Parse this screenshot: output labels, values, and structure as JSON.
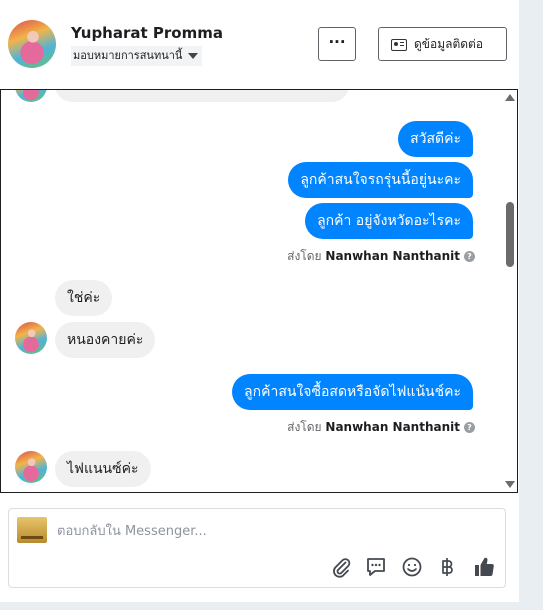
{
  "header": {
    "name": "Yupharat Promma",
    "assign_label": "มอบหมายการสนทนานี้",
    "more_label": "···",
    "contact_label": "ดูข้อมูลติดต่อ"
  },
  "messages": {
    "out_1": "สวัสดีค่ะ",
    "out_2": "ลูกค้าสนใจรถรุ่นนี้อยู่นะคะ",
    "out_3": "ลูกค้า  อยู่จังหวัดอะไรคะ",
    "sent_by_1_prefix": "ส่งโดย",
    "sent_by_1_name": "Nanwhan Nanthanit",
    "in_1": "ใช่ค่ะ",
    "in_2": "หนองคายค่ะ",
    "out_4": "ลูกค้าสนใจซื้อสดหรือจัดไฟแน้นช์คะ",
    "sent_by_2_prefix": "ส่งโดย",
    "sent_by_2_name": "Nanwhan Nanthanit",
    "in_3": "ไฟแนนซ์ค่ะ",
    "help_glyph": "?"
  },
  "composer": {
    "placeholder": "ตอบกลับใน Messenger..."
  },
  "icons": [
    "attachment-icon",
    "saved-reply-icon",
    "emoji-icon",
    "baht-icon",
    "thumbs-up-icon"
  ],
  "colors": {
    "outgoing_bubble": "#0084ff",
    "incoming_bubble": "#f0f0f0",
    "accent": "#1877f2"
  }
}
